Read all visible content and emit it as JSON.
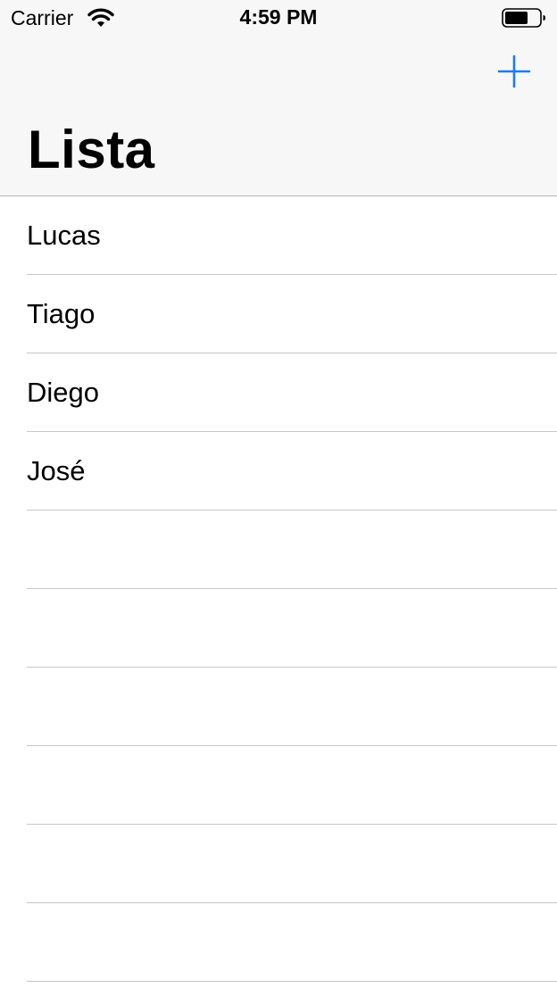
{
  "status_bar": {
    "carrier": "Carrier",
    "time": "4:59 PM"
  },
  "nav": {
    "title": "Lista",
    "add_icon": "plus-icon",
    "accent_color": "#1a7cf5"
  },
  "list": {
    "items": [
      {
        "label": "Lucas"
      },
      {
        "label": "Tiago"
      },
      {
        "label": "Diego"
      },
      {
        "label": "José"
      },
      {
        "label": ""
      },
      {
        "label": ""
      },
      {
        "label": ""
      },
      {
        "label": ""
      },
      {
        "label": ""
      },
      {
        "label": ""
      }
    ]
  }
}
